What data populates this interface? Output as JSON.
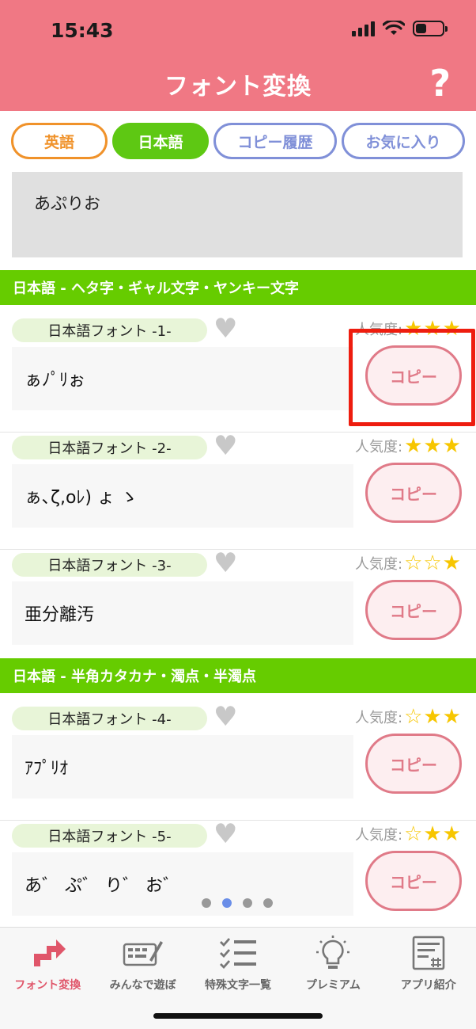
{
  "status_bar": {
    "time": "15:43"
  },
  "header": {
    "title": "フォント変換",
    "help_icon": "?"
  },
  "tabs": [
    {
      "label": "英語"
    },
    {
      "label": "日本語"
    },
    {
      "label": "コピー履歴"
    },
    {
      "label": "お気に入り"
    }
  ],
  "input": {
    "value": "あぷりお"
  },
  "sections": [
    {
      "title": "日本語 - ヘタ字・ギャル文字・ヤンキー文字"
    },
    {
      "title": "日本語 - 半角カタカナ・濁点・半濁点"
    }
  ],
  "popularity_label": "人気度:",
  "copy_label": "コピー",
  "fonts": [
    {
      "label": "日本語フォント -1-",
      "sample": "ぁﾉﾟﾘぉ",
      "stars": 3
    },
    {
      "label": "日本語フォント -2-",
      "sample": "ぁ､ζ,oﾚ) ょ ゝ",
      "stars": 3
    },
    {
      "label": "日本語フォント -3-",
      "sample": "亜分離汚",
      "stars": 1
    },
    {
      "label": "日本語フォント -4-",
      "sample": "ｱﾌﾟﾘｵ",
      "stars": 2
    },
    {
      "label": "日本語フォント -5-",
      "sample": "あ゛ ぷ゛ り゛ お゛",
      "stars": 2
    }
  ],
  "pagination": {
    "pages": 4,
    "active": 2
  },
  "bottom_nav": [
    {
      "label": "フォント変換",
      "icon": "convert-arrows-icon"
    },
    {
      "label": "みんなで遊ぼ",
      "icon": "keyboard-pen-icon"
    },
    {
      "label": "特殊文字一覧",
      "icon": "checklist-icon"
    },
    {
      "label": "プレミアム",
      "icon": "lightbulb-icon"
    },
    {
      "label": "アプリ紹介",
      "icon": "document-hash-icon"
    }
  ],
  "colors": {
    "header": "#f07884",
    "accent_green": "#66cc00",
    "copy_button": "#e07a88",
    "star": "#f7c600",
    "highlight": "#ee1d0f"
  }
}
